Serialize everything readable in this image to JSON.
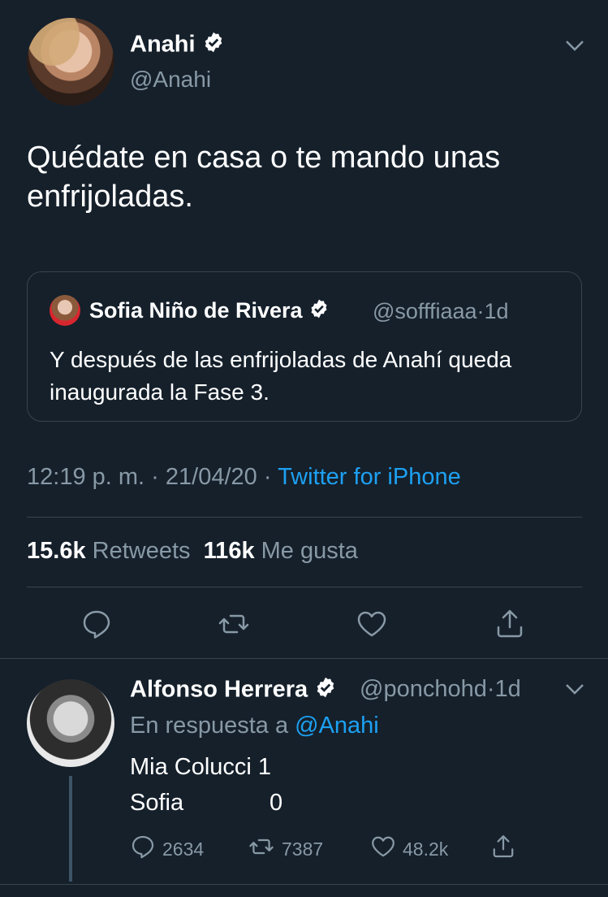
{
  "main_tweet": {
    "author_name": "Anahi",
    "author_handle": "@Anahi",
    "text": "Quédate en casa o te mando unas enfrijoladas.",
    "quoted": {
      "author_name": "Sofia Niño de Rivera",
      "author_handle": "@sofffiaaa",
      "separator": "·",
      "time": "1d",
      "text": "Y después de las enfrijoladas de Anahí queda inaugurada la Fase 3."
    },
    "time": "12:19 p. m.",
    "date": "21/04/20",
    "dot": "·",
    "source": "Twitter for iPhone",
    "retweets_count": "15.6k",
    "retweets_label": "Retweets",
    "likes_count": "116k",
    "likes_label": "Me gusta"
  },
  "reply": {
    "author_name": "Alfonso Herrera",
    "author_handle": "@ponchohd",
    "separator": "·",
    "time": "1d",
    "in_reply_prefix": "En respuesta a",
    "in_reply_handle": "@Anahi",
    "line1": "Mia Colucci 1",
    "line2_name": "Sofia",
    "line2_score": "0",
    "replies": "2634",
    "retweets": "7387",
    "likes": "48.2k"
  },
  "colors": {
    "background": "#15202b",
    "accent": "#1da1f2",
    "muted": "#8899a6",
    "divider": "#38444d"
  },
  "icons": [
    "verified-badge-icon",
    "chevron-down-icon",
    "reply-icon",
    "retweet-icon",
    "like-icon",
    "share-icon"
  ]
}
